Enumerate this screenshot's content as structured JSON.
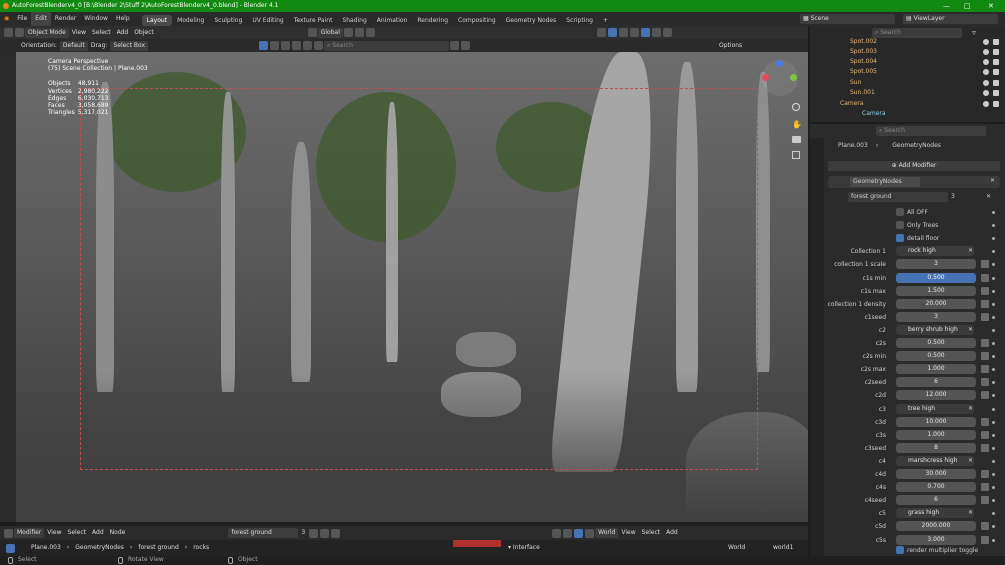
{
  "window": {
    "title": "AutoForestBlenderv4_0 [B:\\Blender 2\\Stuff 2\\AutoForestBlenderv4_0.blend] - Blender 4.1"
  },
  "menu": [
    "File",
    "Edit",
    "Render",
    "Window",
    "Help"
  ],
  "workspaces": [
    "Layout",
    "Modeling",
    "Sculpting",
    "UV Editing",
    "Texture Paint",
    "Shading",
    "Animation",
    "Rendering",
    "Compositing",
    "Geometry Nodes",
    "Scripting"
  ],
  "scene": {
    "name": "Scene",
    "view_layer": "ViewLayer"
  },
  "viewport_header": {
    "mode": "Object Mode",
    "view": "View",
    "select": "Select",
    "add": "Add",
    "object": "Object",
    "transform": "Global",
    "search_placeholder": "Search"
  },
  "tool_settings": {
    "orientation_label": "Orientation:",
    "orientation": "Default",
    "drag_label": "Drag:",
    "drag": "Select Box",
    "options": "Options"
  },
  "overlay": {
    "title": "Camera Perspective",
    "subtitle": "(75) Scene Collection | Plane.003",
    "stats": [
      {
        "k": "Objects",
        "v": "48,911"
      },
      {
        "k": "Vertices",
        "v": "2,980,222"
      },
      {
        "k": "Edges",
        "v": "6,030,713"
      },
      {
        "k": "Faces",
        "v": "3,058,689"
      },
      {
        "k": "Triangles",
        "v": "5,317,021"
      }
    ]
  },
  "outliner": {
    "search_placeholder": "Search",
    "items": [
      "Spot.002",
      "Spot.003",
      "Spot.004",
      "Spot.005",
      "Sun",
      "Sun.001",
      "Camera",
      "Camera"
    ]
  },
  "properties": {
    "search_placeholder": "Search",
    "object": "Plane.003",
    "modifier_context": "GeometryNodes",
    "add_modifier": "Add Modifier",
    "modifier_name": "GeometryNodes",
    "node_group": "forest ground",
    "node_group_users": "3",
    "checkboxes": [
      {
        "label": "All OFF",
        "on": false
      },
      {
        "label": "Only Trees",
        "on": false
      },
      {
        "label": "detail floor",
        "on": true
      }
    ],
    "fields": [
      {
        "label": "Collection 1",
        "type": "coll",
        "value": "rock high"
      },
      {
        "label": "collection 1 scale",
        "type": "num",
        "value": "3"
      },
      {
        "label": "c1s min",
        "type": "num",
        "value": "0.500",
        "sel": true
      },
      {
        "label": "c1s max",
        "type": "num",
        "value": "1.500"
      },
      {
        "label": "collection 1 density",
        "type": "num",
        "value": "20.000"
      },
      {
        "label": "c1seed",
        "type": "num",
        "value": "3"
      },
      {
        "label": "c2",
        "type": "coll",
        "value": "berry shrub high"
      },
      {
        "label": "c2s",
        "type": "num",
        "value": "0.500"
      },
      {
        "label": "c2s min",
        "type": "num",
        "value": "0.500"
      },
      {
        "label": "c2s max",
        "type": "num",
        "value": "1.000"
      },
      {
        "label": "c2seed",
        "type": "num",
        "value": "6"
      },
      {
        "label": "c2d",
        "type": "num",
        "value": "12.000"
      },
      {
        "label": "c3",
        "type": "coll",
        "value": "tree high"
      },
      {
        "label": "c3d",
        "type": "num",
        "value": "10.000"
      },
      {
        "label": "c3s",
        "type": "num",
        "value": "1.000"
      },
      {
        "label": "c3seed",
        "type": "num",
        "value": "8"
      },
      {
        "label": "c4",
        "type": "coll",
        "value": "marshcress high"
      },
      {
        "label": "c4d",
        "type": "num",
        "value": "30.000"
      },
      {
        "label": "c4s",
        "type": "num",
        "value": "0.700"
      },
      {
        "label": "c4seed",
        "type": "num",
        "value": "6"
      },
      {
        "label": "c5",
        "type": "coll",
        "value": "grass high"
      },
      {
        "label": "c5d",
        "type": "num",
        "value": "2000.000"
      },
      {
        "label": "c5s",
        "type": "num",
        "value": "3.000"
      }
    ],
    "last_checkbox": "render multiplier toggle"
  },
  "node_editor": {
    "type": "Modifier",
    "view": "View",
    "select": "Select",
    "add": "Add",
    "node": "Node",
    "group": "forest ground",
    "users": "3",
    "breadcrumb": [
      "Plane.003",
      "GeometryNodes",
      "forest ground",
      "rocks"
    ],
    "interface": "Interface",
    "world": "World",
    "view2": "View",
    "select2": "Select",
    "add2": "Add",
    "world_name": "World",
    "world_node": "world1"
  },
  "status": {
    "select": "Select",
    "rotate": "Rotate View",
    "object": "Object"
  },
  "colors": {
    "accent": "#4772b3",
    "title_bar": "#128a12",
    "camera_frame": "#c05050"
  }
}
